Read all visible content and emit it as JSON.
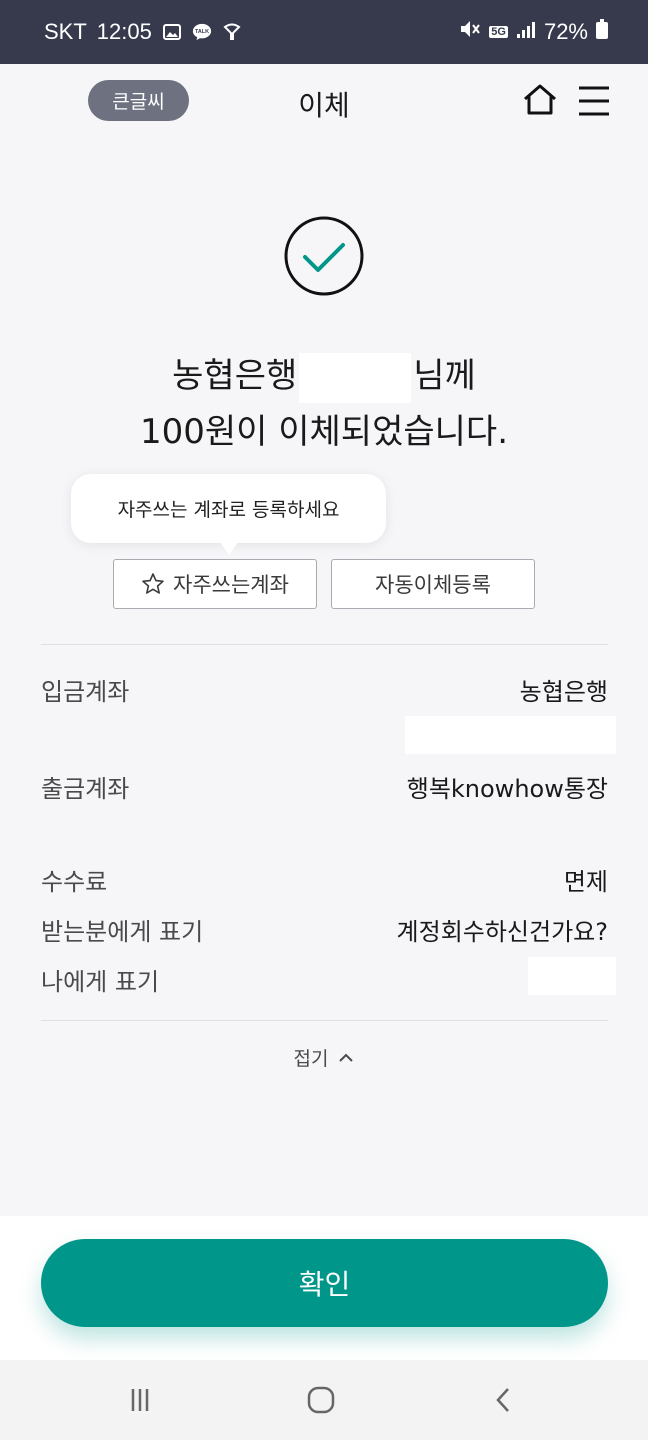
{
  "status_bar": {
    "carrier": "SKT",
    "time": "12:05",
    "network": "5G",
    "battery": "72%"
  },
  "header": {
    "big_font_label": "큰글씨",
    "title": "이체"
  },
  "result": {
    "bank": "농협은행",
    "recipient_suffix": "님께",
    "message": "100원이 이체되었습니다."
  },
  "tooltip": {
    "text": "자주쓰는 계좌로 등록하세요"
  },
  "actions": {
    "favorite_label": "자주쓰는계좌",
    "auto_transfer_label": "자동이체등록"
  },
  "details": {
    "deposit_account_label": "입금계좌",
    "deposit_account_value": "농협은행",
    "withdraw_account_label": "출금계좌",
    "withdraw_account_value": "행복knowhow통장",
    "fee_label": "수수료",
    "fee_value": "면제",
    "recipient_memo_label": "받는분에게 표기",
    "recipient_memo_value": "계정회수하신건가요?",
    "my_memo_label": "나에게 표기"
  },
  "fold_label": "접기",
  "confirm_label": "확인",
  "colors": {
    "status_bar": "#373a4d",
    "accent": "#00968a",
    "badge": "#6d7180",
    "background": "#f6f6f9"
  }
}
